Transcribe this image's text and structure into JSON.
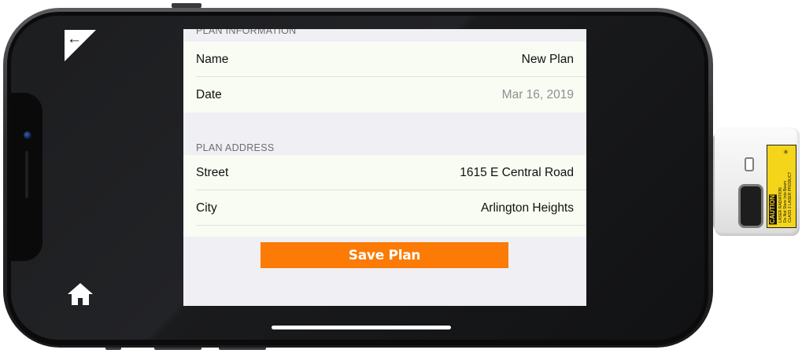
{
  "nav": {
    "back_label": "←",
    "back_icon": "back-arrow-icon",
    "home_icon": "home-icon"
  },
  "plan_information": {
    "header": "PLAN INFORMATION",
    "rows": [
      {
        "label": "Name",
        "value": "New Plan"
      },
      {
        "label": "Date",
        "value": "Mar 16, 2019"
      }
    ]
  },
  "plan_address": {
    "header": "PLAN ADDRESS",
    "rows": [
      {
        "label": "Street",
        "value": "1615 E  Central Road"
      },
      {
        "label": "City",
        "value": "Arlington Heights"
      }
    ]
  },
  "actions": {
    "save_label": "Save Plan"
  },
  "colors": {
    "accent": "#fb7b06",
    "row_background": "#f9fcf2",
    "group_background": "#efeff4"
  },
  "device_label": {
    "caution": "CAUTION",
    "text_1": "LASER RADIATION",
    "text_2": "Do Not Stare Into Beam",
    "text_3": "CLASS 2 LASER PRODUCT"
  }
}
